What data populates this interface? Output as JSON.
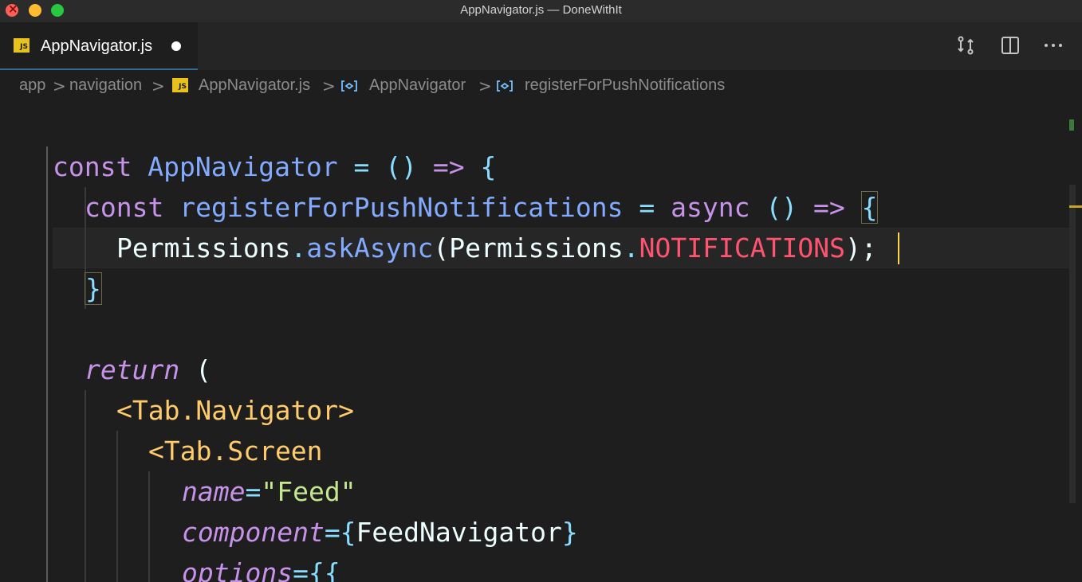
{
  "window": {
    "title": "AppNavigator.js — DoneWithIt"
  },
  "tab": {
    "label": "AppNavigator.js",
    "badge": "JS"
  },
  "breadcrumbs": {
    "items": [
      "app",
      "navigation",
      "AppNavigator.js",
      "AppNavigator",
      "registerForPushNotifications"
    ],
    "separator": ">"
  },
  "code": {
    "l1": {
      "t1": "const",
      "t2": "AppNavigator",
      "t3": "=",
      "t4": "()",
      "t5": "=>",
      "t6": "{"
    },
    "l2": {
      "t1": "const",
      "t2": "registerForPushNotifications",
      "t3": "=",
      "t4": "async",
      "t5": "()",
      "t6": "=>",
      "t7": "{"
    },
    "l3": {
      "t1": "Permissions",
      "t2": ".",
      "t3": "askAsync",
      "t4": "(",
      "t5": "Permissions",
      "t6": ".",
      "t7": "NOTIFICATIONS",
      "t8": ");"
    },
    "l4": {
      "t1": "}"
    },
    "l5": {
      "t1": "return",
      "t2": "("
    },
    "l6": {
      "t1": "<Tab.Navigator>"
    },
    "l7": {
      "t1": "<Tab.Screen"
    },
    "l8": {
      "t1": "name",
      "t2": "=",
      "t3": "\"Feed\""
    },
    "l9": {
      "t1": "component",
      "t2": "={",
      "t3": "FeedNavigator",
      "t4": "}"
    },
    "l10": {
      "t1": "options",
      "t2": "={{"
    }
  },
  "icons": {
    "compare": "compare-changes-icon",
    "split": "split-editor-icon",
    "more": "more-actions-icon",
    "symbol": "symbol-variable-icon"
  },
  "colors": {
    "keyword": "#c792ea",
    "function": "#82aaff",
    "operator": "#89ddff",
    "tag": "#ffcb6b",
    "string": "#c3e88d",
    "constant": "#ff5370",
    "jsBadge": "#e8c21b"
  }
}
